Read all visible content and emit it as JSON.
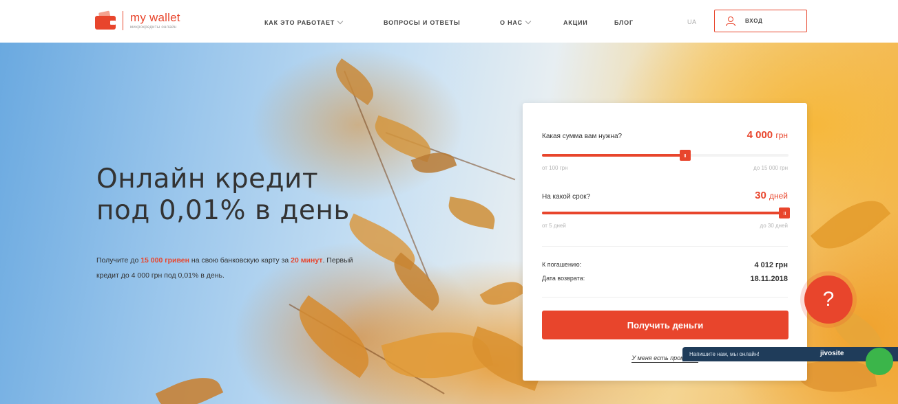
{
  "header": {
    "logo_name": "my wallet",
    "logo_tagline": "микрокредиты онлайн",
    "nav": [
      {
        "label": "КАК ЭТО РАБОТАЕТ",
        "has_dropdown": true
      },
      {
        "label": "ВОПРОСЫ И ОТВЕТЫ",
        "has_dropdown": false
      },
      {
        "label": "О НАС",
        "has_dropdown": true
      },
      {
        "label": "АКЦИИ",
        "has_dropdown": false
      },
      {
        "label": "БЛОГ",
        "has_dropdown": false
      }
    ],
    "lang": "UA",
    "login_label": "ВХОД"
  },
  "hero": {
    "title_line1": "Онлайн кредит",
    "title_line2": "под 0,01% в день",
    "sub_part1": "Получите до ",
    "sub_accent1": "15 000 гривен",
    "sub_part2": " на свою банковскую карту за ",
    "sub_accent2": "20 минут",
    "sub_part3": ". Первый кредит до 4 000 грн под 0,01% в день."
  },
  "calculator": {
    "amount_question": "Какая сумма вам нужна?",
    "amount_value": "4 000",
    "amount_unit": "грн",
    "amount_min_label": "от 100 грн",
    "amount_max_label": "до 15 000 грн",
    "amount_fraction": 0.58,
    "term_question": "На какой срок?",
    "term_value": "30",
    "term_unit": "дней",
    "term_min_label": "от 5 дней",
    "term_max_label": "до 30 дней",
    "term_fraction": 1.0,
    "repay_label": "К погашению:",
    "repay_value": "4 012 грн",
    "return_date_label": "Дата возврата:",
    "return_date_value": "18.11.2018",
    "cta_label": "Получить деньги",
    "promo_label": "У меня есть промокод"
  },
  "help": {
    "symbol": "?"
  },
  "chat": {
    "text": "Напишите нам, мы онлайн!",
    "brand": "jivosite"
  },
  "colors": {
    "accent": "#e8452c",
    "chat_bg": "#1f3c5a",
    "chat_dot": "#3bb54a"
  }
}
